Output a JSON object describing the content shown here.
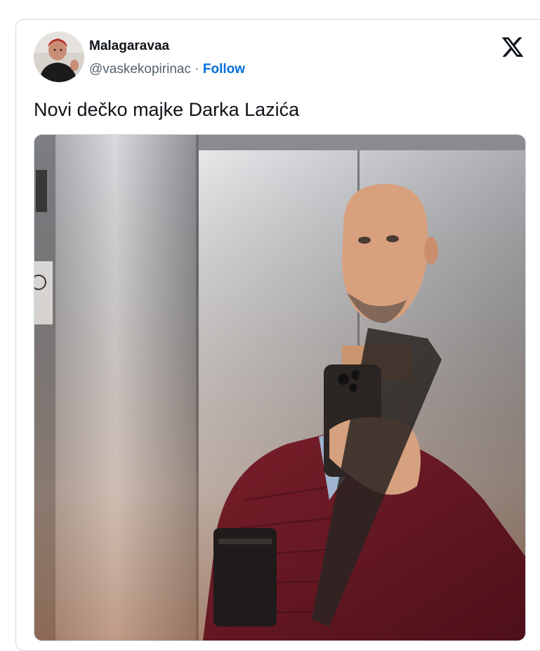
{
  "tweet": {
    "author": {
      "display_name": "Malagaravaa",
      "handle": "@vaskekopirinac",
      "separator": " · ",
      "avatar_icon": "profile-photo"
    },
    "follow_label": "Follow",
    "platform_icon": "x-logo-icon",
    "text": "Novi dečko majke Darka Lazića",
    "media": {
      "type": "photo",
      "alt_icon": "elevator-selfie-photo"
    }
  },
  "colors": {
    "follow": "#006fd6",
    "handle": "#536471",
    "text": "#0f1419",
    "border": "#cfd9de"
  }
}
